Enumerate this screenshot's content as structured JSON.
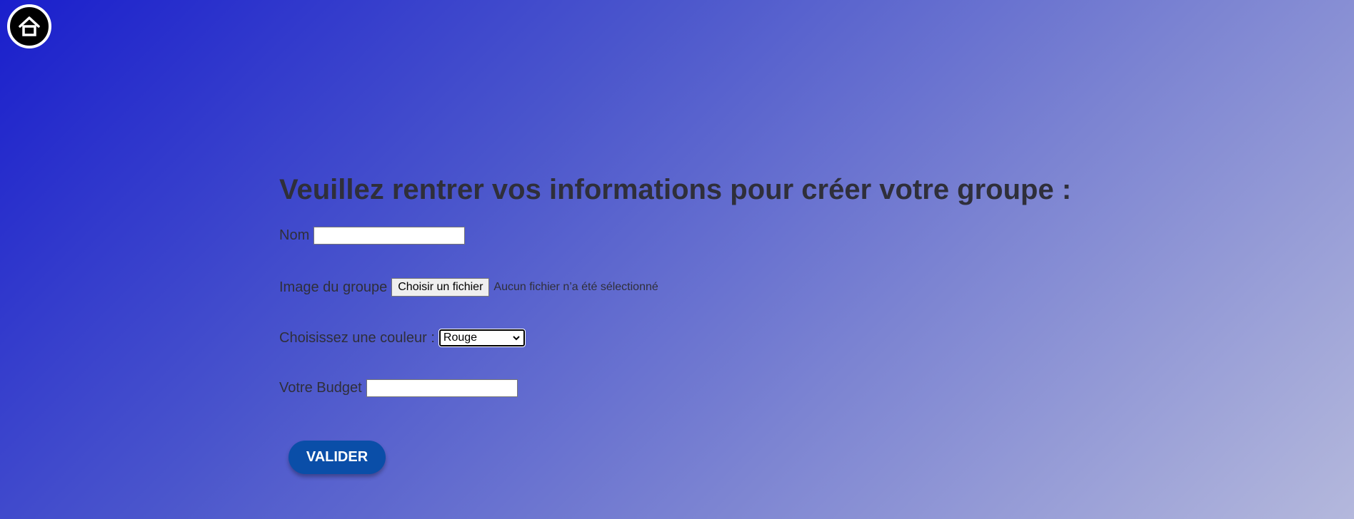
{
  "home": {
    "icon": "home-icon"
  },
  "form": {
    "title": "Veuillez rentrer vos informations pour créer votre groupe :",
    "nom_label": "Nom",
    "nom_value": "",
    "image_label": "Image du groupe",
    "file_button_label": "Choisir un fichier",
    "file_status": "Aucun fichier n’a été sélectionné",
    "couleur_label": "Choisissez une couleur :",
    "couleur_selected": "Rouge",
    "budget_label": "Votre Budget",
    "budget_value": "",
    "submit_label": "VALIDER"
  },
  "colors": {
    "submit_button": "#0a4ea8",
    "text": "#2f2f3a"
  }
}
